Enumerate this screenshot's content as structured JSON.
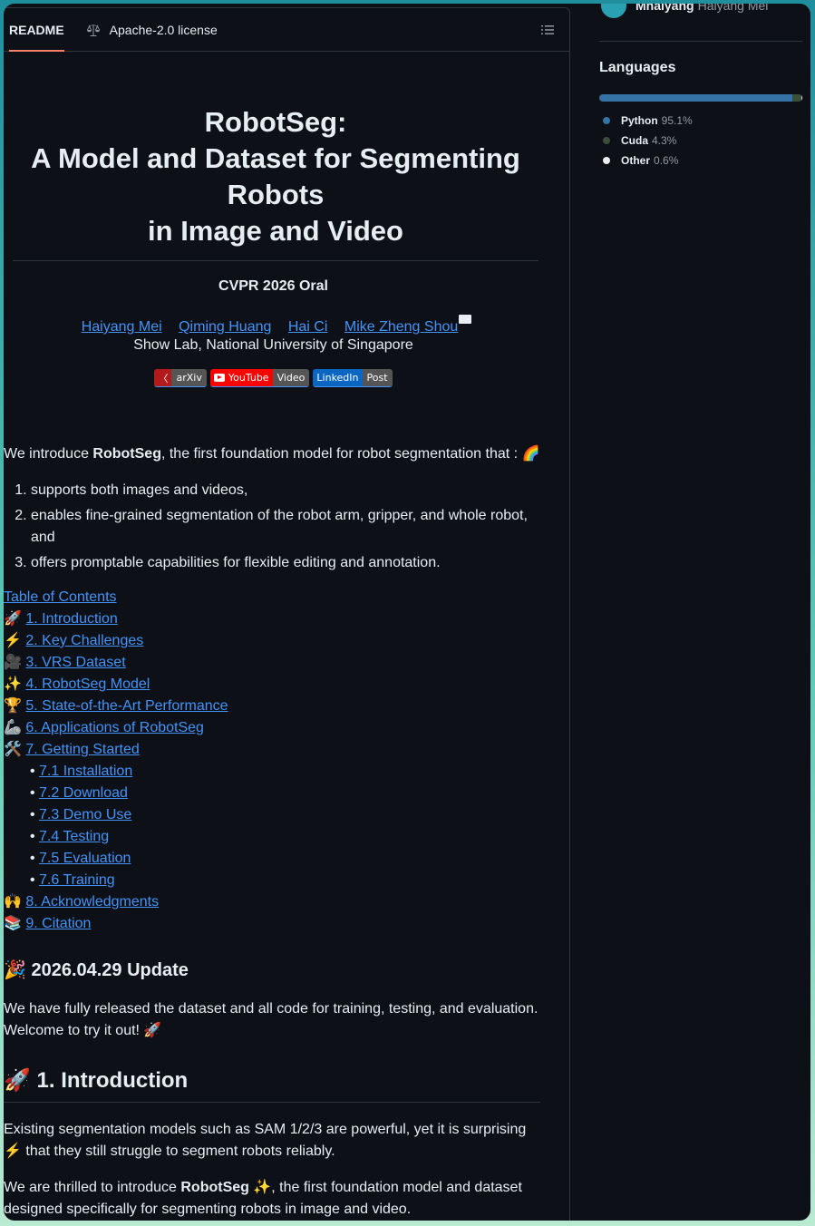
{
  "tabs": {
    "readme": "README",
    "license": "Apache-2.0 license"
  },
  "title_lines": [
    "RobotSeg:",
    "A Model and Dataset for Segmenting",
    "Robots",
    "in Image and Video"
  ],
  "conference": "CVPR 2026 Oral",
  "authors": [
    "Haiyang Mei",
    "Qiming Huang",
    "Hai Ci",
    "Mike Zheng Shou"
  ],
  "affiliation": "Show Lab, National University of Singapore",
  "badges": {
    "arxiv": {
      "left": "arXiv",
      "right": ""
    },
    "youtube": {
      "left": "YouTube",
      "right": "Video"
    },
    "linkedin": {
      "left": "LinkedIn",
      "right": "Post"
    }
  },
  "intro": {
    "pre": "We introduce ",
    "bold": "RobotSeg",
    "post": ", the first foundation model for robot segmentation that : 🌈"
  },
  "features": [
    "supports both images and videos,",
    "enables fine-grained segmentation of the robot arm, gripper, and whole robot, and",
    "offers promptable capabilities for flexible editing and annotation."
  ],
  "toc": {
    "header": "Table of Contents",
    "items": [
      {
        "emoji": "🚀",
        "label": "1. Introduction"
      },
      {
        "emoji": "⚡",
        "label": "2. Key Challenges"
      },
      {
        "emoji": "🎥",
        "label": "3. VRS Dataset"
      },
      {
        "emoji": "✨",
        "label": "4. RobotSeg Model"
      },
      {
        "emoji": "🏆",
        "label": "5. State-of-the-Art Performance"
      },
      {
        "emoji": "🦾",
        "label": "6. Applications of RobotSeg"
      },
      {
        "emoji": "🛠️",
        "label": "7. Getting Started"
      }
    ],
    "subitems": [
      "7.1 Installation",
      "7.2 Download",
      "7.3 Demo Use",
      "7.4 Testing",
      "7.5 Evaluation",
      "7.6 Training"
    ],
    "tail": [
      {
        "emoji": "🙌",
        "label": "8. Acknowledgments"
      },
      {
        "emoji": "📚",
        "label": "9. Citation"
      }
    ]
  },
  "update": {
    "heading": "🎉 2026.04.29 Update",
    "text": "We have fully released the dataset and all code for training, testing, and evaluation. Welcome to try it out! 🚀"
  },
  "section1": {
    "heading": "🚀 1. Introduction",
    "p1": "Existing segmentation models such as SAM 1/2/3 are powerful, yet it is surprising ⚡ that they still struggle to segment robots reliably.",
    "p2_pre": "We are thrilled to introduce ",
    "p2_bold": "RobotSeg",
    "p2_post": " ✨, the first foundation model and dataset designed specifically for segmenting robots in image and video."
  },
  "sidebar": {
    "contributor_handle": "Mhaiyang",
    "contributor_name": "Haiyang Mei",
    "languages_title": "Languages",
    "languages": [
      {
        "name": "Python",
        "percent": "95.1%",
        "value": 95.1,
        "color": "#3572A5"
      },
      {
        "name": "Cuda",
        "percent": "4.3%",
        "value": 4.3,
        "color": "#3A4E3A"
      },
      {
        "name": "Other",
        "percent": "0.6%",
        "value": 0.6,
        "color": "#ededed"
      }
    ]
  }
}
